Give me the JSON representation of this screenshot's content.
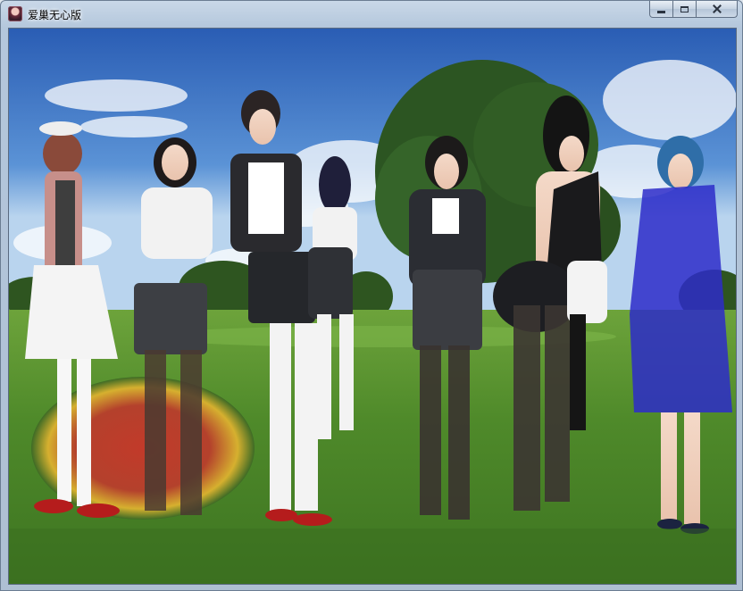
{
  "window": {
    "title": "爱巢无心版",
    "icon": "app-avatar-icon",
    "controls": [
      "minimize-icon",
      "maximize-icon",
      "close-icon"
    ]
  },
  "scene": {
    "description_icon": "game-scene-image",
    "colors": {
      "sky": "#3f76c4",
      "grass": "#4f8a2a",
      "tree": "#2f5a24"
    }
  }
}
